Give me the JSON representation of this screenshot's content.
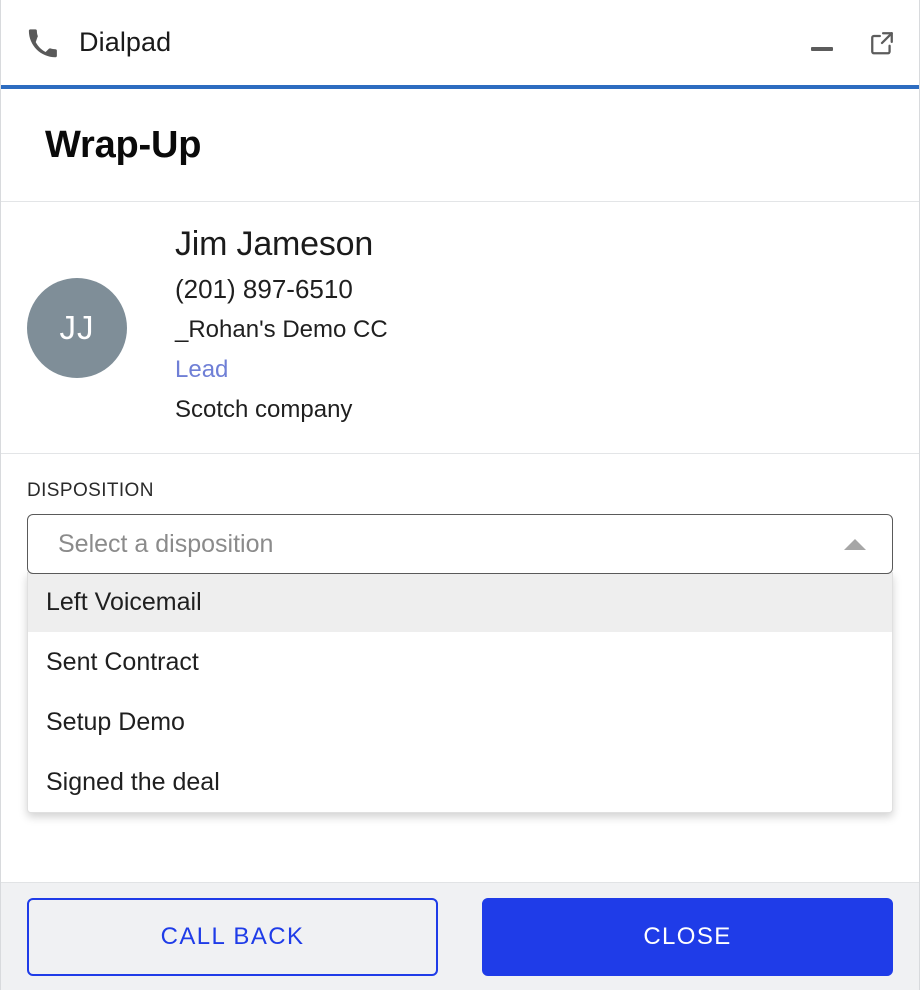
{
  "window": {
    "app_title": "Dialpad",
    "phone_icon": "phone-icon",
    "minimize_label": "Minimize",
    "popout_label": "Pop out",
    "accent_bar_color": "#2d6cc0"
  },
  "heading": {
    "title": "Wrap-Up"
  },
  "contact": {
    "avatar_initials": "JJ",
    "avatar_color": "#7f8e98",
    "name": "Jim Jameson",
    "phone": "(201) 897-6510",
    "organization": "_Rohan's Demo CC",
    "type": "Lead",
    "type_color": "#6f7fd6",
    "company": "Scotch company"
  },
  "disposition": {
    "label": "DISPOSITION",
    "placeholder": "Select a disposition",
    "value": "",
    "caret_icon": "caret-up-icon",
    "expanded": true,
    "options": [
      {
        "label": "Left Voicemail",
        "highlighted": true
      },
      {
        "label": "Sent Contract",
        "highlighted": false
      },
      {
        "label": "Setup Demo",
        "highlighted": false
      },
      {
        "label": "Signed the deal",
        "highlighted": false
      }
    ]
  },
  "footer": {
    "call_back_label": "CALL BACK",
    "close_label": "CLOSE",
    "primary_color": "#1f3ce8",
    "background": "#f0f1f3"
  }
}
